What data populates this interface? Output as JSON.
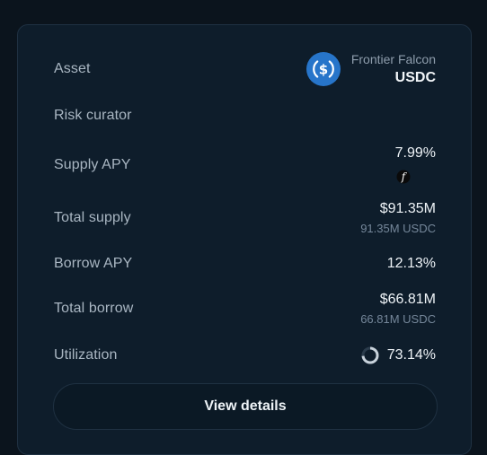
{
  "market": {
    "rows": {
      "asset": {
        "label": "Asset",
        "vault_name": "Frontier Falcon",
        "symbol": "USDC",
        "icon": "usdc-icon",
        "icon_color": "#2775ca"
      },
      "risk_curator": {
        "label": "Risk curator"
      },
      "supply_apy": {
        "label": "Supply APY",
        "value": "7.99%",
        "reward_icon": "reward-f-icon"
      },
      "total_supply": {
        "label": "Total supply",
        "value": "$91.35M",
        "sub_value": "91.35M USDC"
      },
      "borrow_apy": {
        "label": "Borrow APY",
        "value": "12.13%"
      },
      "total_borrow": {
        "label": "Total borrow",
        "value": "$66.81M",
        "sub_value": "66.81M USDC"
      },
      "utilization": {
        "label": "Utilization",
        "value": "73.14%",
        "fraction": 0.7314
      }
    },
    "button_label": "View details"
  }
}
